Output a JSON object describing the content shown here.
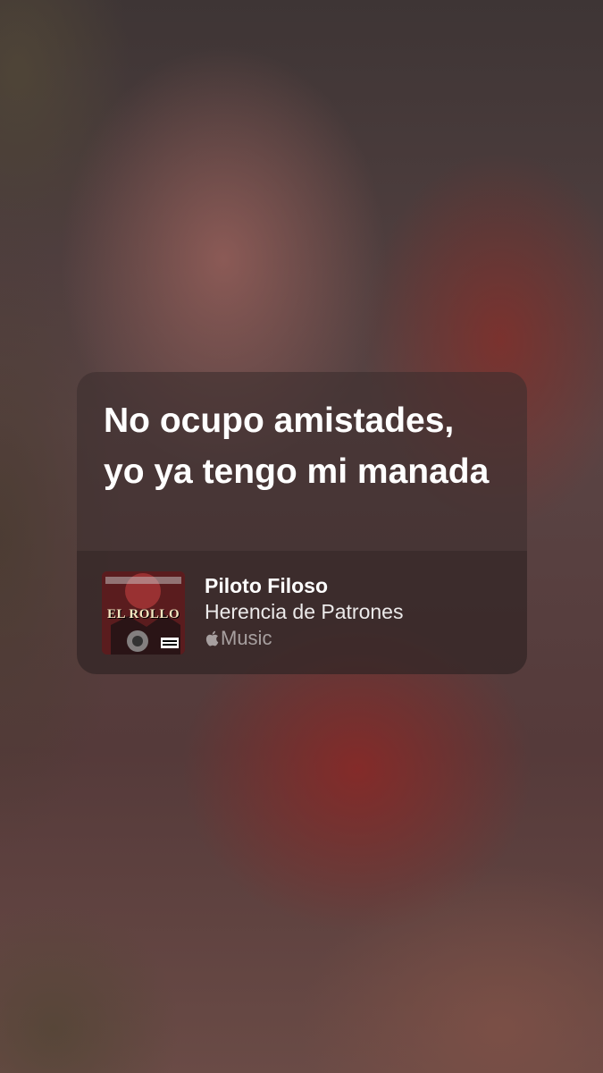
{
  "lyric_card": {
    "lyrics": "No ocupo amistades, yo ya tengo mi manada",
    "song_title": "Piloto Filoso",
    "artist": "Herencia de Patrones",
    "source_label": "Music",
    "source_icon": "apple-logo-icon",
    "album_art": {
      "text": "EL ROLLO",
      "icon": "album-cover-image"
    }
  },
  "colors": {
    "card_background": "#3e2e2e",
    "text_primary": "#ffffff",
    "text_secondary": "#bfb3b3"
  }
}
